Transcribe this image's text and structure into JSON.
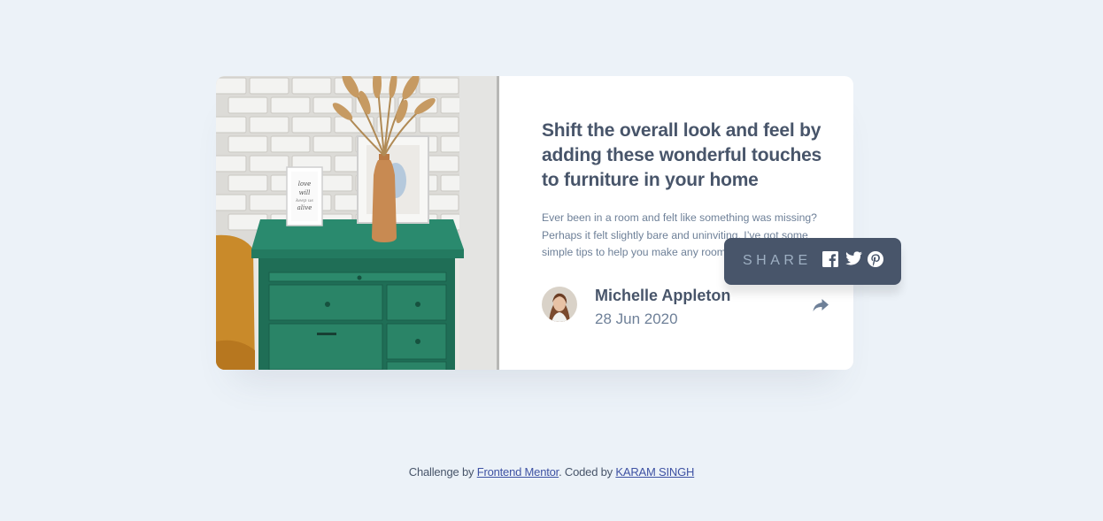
{
  "article": {
    "title": "Shift the overall look and feel by adding these wonderful touches to furniture in your home",
    "description": "Ever been in a room and felt like something was missing? Perhaps it felt slightly bare and uninviting. I’ve got some simple tips to help you make any room feel complete."
  },
  "author": {
    "name": "Michelle Appleton",
    "date": "28 Jun 2020"
  },
  "share": {
    "label": "SHARE",
    "button_icon": "share-arrow-icon",
    "networks": [
      "facebook-icon",
      "twitter-icon",
      "pinterest-icon"
    ]
  },
  "footer": {
    "prefix": "Challenge by",
    "link1": "Frontend Mentor",
    "middle": ". Coded by",
    "link2": "KARAM SINGH"
  },
  "colors": {
    "background": "#ecf2f8",
    "card": "#ffffff",
    "heading": "#48556a",
    "text": "#6e8098",
    "tooltip": "#48556a",
    "tooltip_text": "#9eafc2",
    "link": "#3e52a3"
  }
}
